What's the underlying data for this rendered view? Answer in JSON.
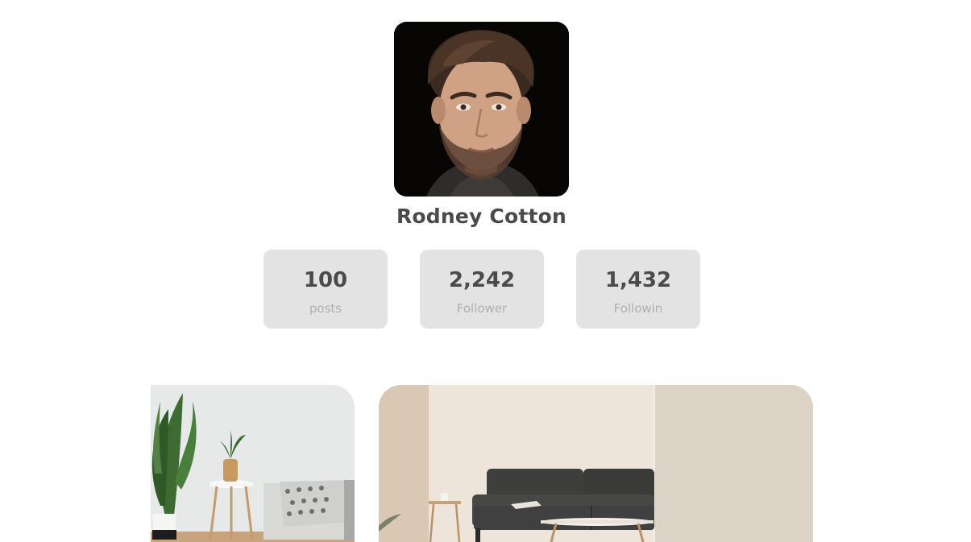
{
  "profile": {
    "name": "Rodney Cotton"
  },
  "stats": [
    {
      "value": "100",
      "label": "posts"
    },
    {
      "value": "2,242",
      "label": "Follower"
    },
    {
      "value": "1,432",
      "label": "Followin"
    }
  ],
  "colors": {
    "background": "#ffffff",
    "card": "#e3e3e3",
    "text_dark": "#4a4a4a",
    "text_muted": "#b0b0b0"
  }
}
